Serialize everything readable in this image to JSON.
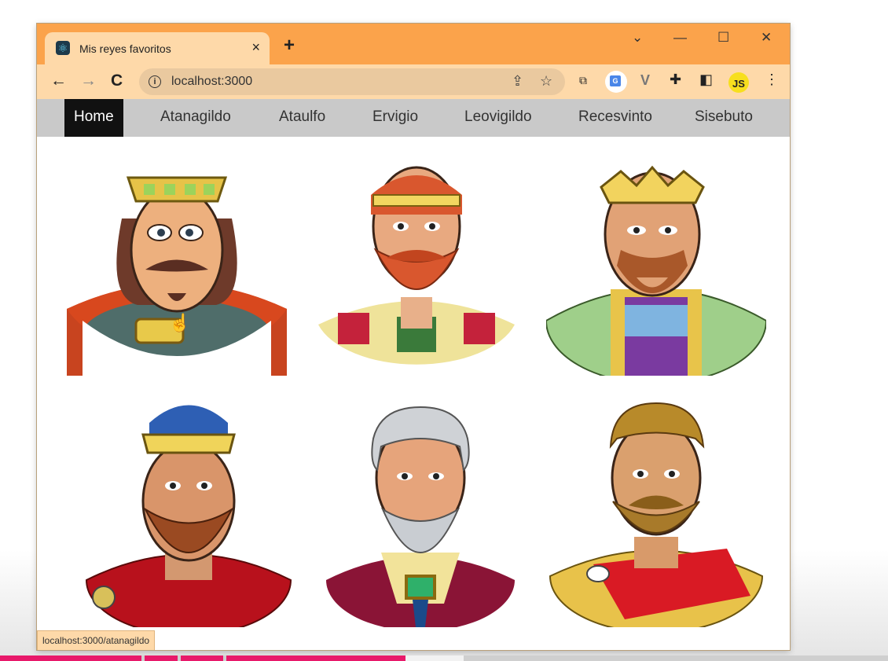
{
  "browser": {
    "tab_title": "Mis reyes favoritos",
    "tab_close": "×",
    "new_tab": "+",
    "window_controls": {
      "tab_search": "⌄",
      "minimize": "—",
      "maximize": "☐",
      "close": "✕"
    },
    "nav": {
      "back": "←",
      "forward": "→",
      "reload": "C"
    },
    "url": "localhost:3000",
    "extensions": [
      "translate-icon",
      "vue-devtools-icon",
      "puzzle-extensions-icon",
      "side-panel-icon",
      "js-extension-icon"
    ],
    "ext_js_label": "JS",
    "menu": "⋮",
    "status_url": "localhost:3000/atanagildo"
  },
  "navbar": {
    "links": [
      "Home",
      "Atanagildo",
      "Ataulfo",
      "Ervigio",
      "Leovigildo",
      "Recesvinto",
      "Sisebuto"
    ],
    "active": "Home"
  },
  "colors": {
    "titlebar": "#fba34b",
    "toolbar": "#fed9a9",
    "navbar": "#c9c9c9",
    "nav_active": "#111111",
    "progress": "#e8196a"
  }
}
